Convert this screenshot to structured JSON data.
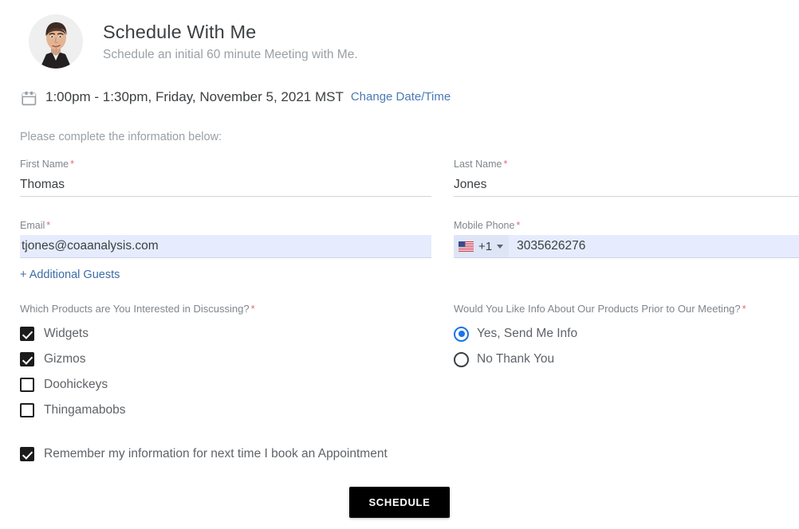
{
  "header": {
    "avatar_alt": "profile-photo",
    "title": "Schedule With Me",
    "subtitle": "Schedule an initial 60 minute Meeting with Me."
  },
  "appointment": {
    "calendar_icon": "calendar-icon",
    "datetime_text": "1:00pm - 1:30pm, Friday, November 5, 2021 MST",
    "change_link_label": "Change Date/Time"
  },
  "instruction": "Please complete the information below:",
  "form": {
    "first_name": {
      "label": "First Name",
      "required_mark": "*",
      "value": "Thomas",
      "placeholder": ""
    },
    "last_name": {
      "label": "Last Name",
      "required_mark": "*",
      "value": "Jones",
      "placeholder": ""
    },
    "email": {
      "label": "Email",
      "required_mark": "*",
      "value": "tjones@coaanalysis.com",
      "placeholder": ""
    },
    "mobile_phone": {
      "label": "Mobile Phone",
      "required_mark": "*",
      "country_flag": "us-flag-icon",
      "country_code": "+1",
      "value": "3035626276",
      "placeholder": ""
    },
    "additional_guests_label": "+ Additional Guests"
  },
  "products_group": {
    "title": "Which Products are You Interested in Discussing?",
    "required_mark": "*",
    "options": [
      {
        "label": "Widgets",
        "checked": true
      },
      {
        "label": "Gizmos",
        "checked": true
      },
      {
        "label": "Doohickeys",
        "checked": false
      },
      {
        "label": "Thingamabobs",
        "checked": false
      }
    ]
  },
  "info_group": {
    "title": "Would You Like Info About Our Products Prior to Our Meeting?",
    "required_mark": "*",
    "options": [
      {
        "label": "Yes, Send Me Info",
        "selected": true
      },
      {
        "label": "No Thank You",
        "selected": false
      }
    ]
  },
  "remember": {
    "label": "Remember my information for next time I book an Appointment",
    "checked": true
  },
  "submit": {
    "label": "SCHEDULE"
  },
  "colors": {
    "accent_blue": "#1a73e8",
    "link_blue": "#3f6ca8",
    "change_link_blue": "#4a7ab5",
    "required_red": "#e06c75",
    "autofill_bg": "#e6ecfd",
    "text_primary": "#3c4043",
    "text_muted": "#80868b",
    "button_bg": "#000000"
  }
}
